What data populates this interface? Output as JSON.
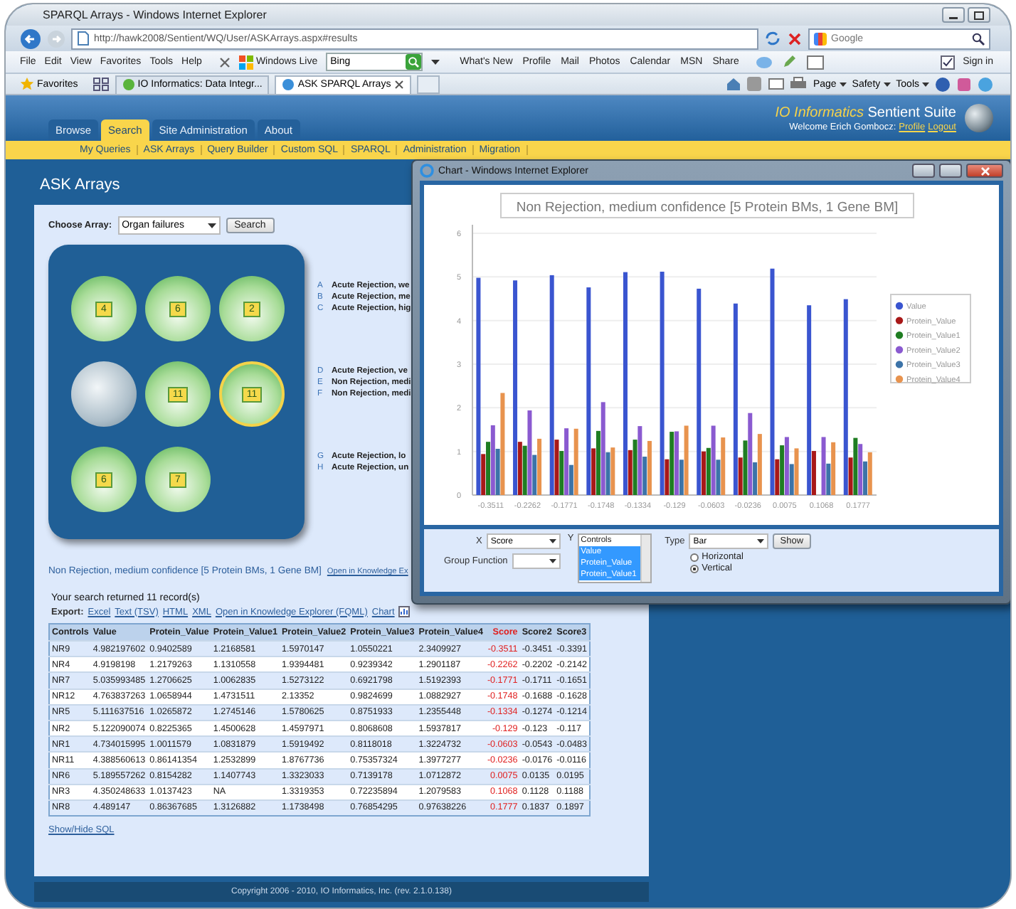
{
  "window": {
    "title": "SPARQL Arrays - Windows Internet Explorer"
  },
  "address_bar": {
    "url": "http://hawk2008/Sentient/WQ/User/ASKArrays.aspx#results",
    "search_placeholder": "Google"
  },
  "menu_bar": [
    "File",
    "Edit",
    "View",
    "Favorites",
    "Tools",
    "Help"
  ],
  "live_toolbar": {
    "brand": "Windows Live",
    "search_value": "Bing",
    "links": [
      "What's New",
      "Profile",
      "Mail",
      "Photos",
      "Calendar",
      "MSN",
      "Share"
    ],
    "sign_in": "Sign in"
  },
  "favorites_bar": {
    "label": "Favorites",
    "tabs": [
      {
        "label": "IO Informatics: Data Integr...",
        "selected": false
      },
      {
        "label": "ASK SPARQL Arrays",
        "selected": true
      }
    ],
    "commands": [
      "Page",
      "Safety",
      "Tools"
    ]
  },
  "app": {
    "brand_highlight": "IO Informatics",
    "brand": "Sentient Suite",
    "welcome": "Welcome Erich Gombocz:",
    "user_links": [
      "Profile",
      "Logout"
    ],
    "tabs": [
      {
        "label": "Browse",
        "selected": false
      },
      {
        "label": "Search",
        "selected": true
      },
      {
        "label": "Site Administration",
        "selected": false
      },
      {
        "label": "About",
        "selected": false
      }
    ],
    "subnav": [
      "My Queries",
      "ASK Arrays",
      "Query Builder",
      "Custom SQL",
      "SPARQL",
      "Administration",
      "Migration"
    ]
  },
  "page": {
    "title": "ASK Arrays",
    "choose_label": "Choose Array:",
    "array_value": "Organ failures",
    "search_button": "Search",
    "wells": [
      {
        "count": "4",
        "kind": "active",
        "selected": false
      },
      {
        "count": "6",
        "kind": "active",
        "selected": false
      },
      {
        "count": "2",
        "kind": "active",
        "selected": false
      },
      {
        "kind": "empty",
        "selected": false
      },
      {
        "count": "11",
        "kind": "active",
        "selected": false
      },
      {
        "count": "11",
        "kind": "active",
        "selected": true
      },
      {
        "count": "6",
        "kind": "active",
        "selected": false
      },
      {
        "count": "7",
        "kind": "active",
        "selected": false
      }
    ],
    "legend_groups": [
      [
        {
          "letter": "A",
          "text": "Acute Rejection, we"
        },
        {
          "letter": "B",
          "text": "Acute Rejection, me"
        },
        {
          "letter": "C",
          "text": "Acute Rejection, hig"
        }
      ],
      [
        {
          "letter": "D",
          "text": "Acute Rejection, ve"
        },
        {
          "letter": "E",
          "text": "Non Rejection, medi"
        },
        {
          "letter": "F",
          "text": "Non Rejection, medi"
        }
      ],
      [
        {
          "letter": "G",
          "text": "Acute Rejection, lo"
        },
        {
          "letter": "H",
          "text": "Acute Rejection, un"
        }
      ]
    ],
    "selected_array_link": "Non Rejection, medium confidence [5 Protein BMs, 1 Gene BM]",
    "knowledge_link": "Open in Knowledge Ex",
    "result_count": "Your search returned 11 record(s)",
    "export_label": "Export:",
    "export_links": [
      "Excel",
      "Text (TSV)",
      "HTML",
      "XML",
      "Open in Knowledge Explorer (FQML)",
      "Chart"
    ],
    "table": {
      "columns": [
        {
          "label": "Controls",
          "highlighted": false
        },
        {
          "label": "Value",
          "highlighted": false
        },
        {
          "label": "Protein_Value",
          "highlighted": false
        },
        {
          "label": "Protein_Value1",
          "highlighted": false
        },
        {
          "label": "Protein_Value2",
          "highlighted": false
        },
        {
          "label": "Protein_Value3",
          "highlighted": false
        },
        {
          "label": "Protein_Value4",
          "highlighted": false
        },
        {
          "label": "Score",
          "highlighted": true
        },
        {
          "label": "Score2",
          "highlighted": false
        },
        {
          "label": "Score3",
          "highlighted": false
        }
      ],
      "rows": [
        [
          "NR9",
          "4.982197602",
          "0.9402589",
          "1.2168581",
          "1.5970147",
          "1.0550221",
          "2.3409927",
          "-0.3511",
          "-0.3451",
          "-0.3391"
        ],
        [
          "NR4",
          "4.9198198",
          "1.2179263",
          "1.1310558",
          "1.9394481",
          "0.9239342",
          "1.2901187",
          "-0.2262",
          "-0.2202",
          "-0.2142"
        ],
        [
          "NR7",
          "5.035993485",
          "1.2706625",
          "1.0062835",
          "1.5273122",
          "0.6921798",
          "1.5192393",
          "-0.1771",
          "-0.1711",
          "-0.1651"
        ],
        [
          "NR12",
          "4.763837263",
          "1.0658944",
          "1.4731511",
          "2.13352",
          "0.9824699",
          "1.0882927",
          "-0.1748",
          "-0.1688",
          "-0.1628"
        ],
        [
          "NR5",
          "5.111637516",
          "1.0265872",
          "1.2745146",
          "1.5780625",
          "0.8751933",
          "1.2355448",
          "-0.1334",
          "-0.1274",
          "-0.1214"
        ],
        [
          "NR2",
          "5.122090074",
          "0.8225365",
          "1.4500628",
          "1.4597971",
          "0.8068608",
          "1.5937817",
          "-0.129",
          "-0.123",
          "-0.117"
        ],
        [
          "NR1",
          "4.734015995",
          "1.0011579",
          "1.0831879",
          "1.5919492",
          "0.8118018",
          "1.3224732",
          "-0.0603",
          "-0.0543",
          "-0.0483"
        ],
        [
          "NR11",
          "4.388560613",
          "0.86141354",
          "1.2532899",
          "1.8767736",
          "0.75357324",
          "1.3977277",
          "-0.0236",
          "-0.0176",
          "-0.0116"
        ],
        [
          "NR6",
          "5.189557262",
          "0.8154282",
          "1.1407743",
          "1.3323033",
          "0.7139178",
          "1.0712872",
          "0.0075",
          "0.0135",
          "0.0195"
        ],
        [
          "NR3",
          "4.350248633",
          "1.0137423",
          "NA",
          "1.3319353",
          "0.72235894",
          "1.2079583",
          "0.1068",
          "0.1128",
          "0.1188"
        ],
        [
          "NR8",
          "4.489147",
          "0.86367685",
          "1.3126882",
          "1.1738498",
          "0.76854295",
          "0.97638226",
          "0.1777",
          "0.1837",
          "0.1897"
        ]
      ]
    },
    "sql_toggle": "Show/Hide SQL"
  },
  "chart_window": {
    "title": "Chart - Windows Internet Explorer",
    "chart_data": {
      "type": "bar",
      "title": "Non Rejection, medium confidence [5 Protein BMs, 1 Gene BM]",
      "categories": [
        "-0.3511",
        "-0.2262",
        "-0.1771",
        "-0.1748",
        "-0.1334",
        "-0.129",
        "-0.0603",
        "-0.0236",
        "0.0075",
        "0.1068",
        "0.1777"
      ],
      "ylim": [
        0,
        6
      ],
      "yticks": [
        0,
        1,
        2,
        3,
        4,
        5,
        6
      ],
      "grid": true,
      "legend": "right",
      "series": [
        {
          "name": "Value",
          "color": "#3a55d0",
          "values": [
            4.98,
            4.92,
            5.04,
            4.76,
            5.11,
            5.12,
            4.73,
            4.39,
            5.19,
            4.35,
            4.49
          ]
        },
        {
          "name": "Protein_Value",
          "color": "#a81818",
          "values": [
            0.94,
            1.22,
            1.27,
            1.07,
            1.03,
            0.82,
            1.0,
            0.86,
            0.82,
            1.01,
            0.86
          ]
        },
        {
          "name": "Protein_Value1",
          "color": "#1f7d22",
          "values": [
            1.22,
            1.13,
            1.01,
            1.47,
            1.27,
            1.45,
            1.08,
            1.25,
            1.14,
            null,
            1.31
          ]
        },
        {
          "name": "Protein_Value2",
          "color": "#8a5ad0",
          "values": [
            1.6,
            1.94,
            1.53,
            2.13,
            1.58,
            1.46,
            1.59,
            1.88,
            1.33,
            1.33,
            1.17
          ]
        },
        {
          "name": "Protein_Value3",
          "color": "#3c73a8",
          "values": [
            1.06,
            0.92,
            0.69,
            0.98,
            0.88,
            0.81,
            0.81,
            0.75,
            0.71,
            0.72,
            0.77
          ]
        },
        {
          "name": "Protein_Value4",
          "color": "#e8934e",
          "values": [
            2.34,
            1.29,
            1.52,
            1.09,
            1.24,
            1.59,
            1.32,
            1.4,
            1.07,
            1.21,
            0.98
          ]
        }
      ]
    },
    "controls": {
      "x_label": "X",
      "x_value": "Score",
      "y_label": "Y",
      "y_options": [
        {
          "label": "Controls",
          "selected": false
        },
        {
          "label": "Value",
          "selected": true
        },
        {
          "label": "Protein_Value",
          "selected": true
        },
        {
          "label": "Protein_Value1",
          "selected": true
        }
      ],
      "type_label": "Type",
      "type_value": "Bar",
      "show_button": "Show",
      "group_label": "Group Function",
      "orientations": [
        {
          "label": "Horizontal",
          "selected": false
        },
        {
          "label": "Vertical",
          "selected": true
        }
      ]
    }
  },
  "footer": "Copyright 2006 - 2010, IO Informatics, Inc. (rev. 2.1.0.138)"
}
